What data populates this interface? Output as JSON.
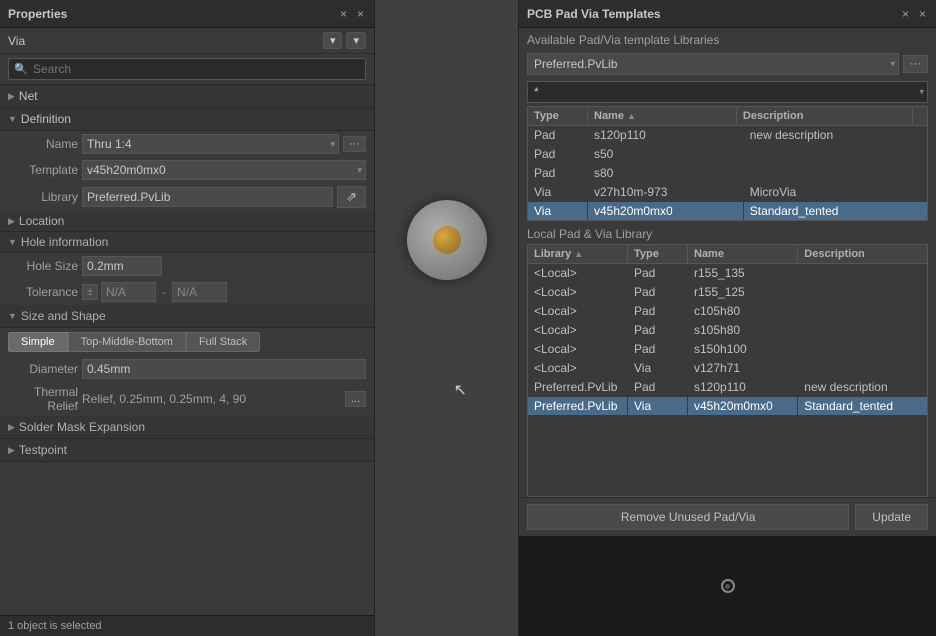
{
  "properties": {
    "title": "Properties",
    "via_label": "Via",
    "search_placeholder": "Search",
    "net_section": "Net",
    "definition_section": "Definition",
    "name_label": "Name",
    "name_value": "Thru 1:4",
    "template_label": "Template",
    "template_value": "v45h20m0mx0",
    "library_label": "Library",
    "library_value": "Preferred.PvLib",
    "location_section": "Location",
    "hole_info_section": "Hole information",
    "hole_size_label": "Hole Size",
    "hole_size_value": "0.2mm",
    "tolerance_label": "Tolerance",
    "tolerance_pm": "±",
    "tolerance_na": "N/A",
    "size_shape_section": "Size and Shape",
    "tab_simple": "Simple",
    "tab_top_middle_bottom": "Top-Middle-Bottom",
    "tab_full_stack": "Full Stack",
    "diameter_label": "Diameter",
    "diameter_value": "0.45mm",
    "thermal_label": "Thermal Relief",
    "thermal_value": "Relief, 0.25mm, 0.25mm, 4, 90",
    "thermal_dots": "...",
    "solder_mask": "Solder Mask Expansion",
    "testpoint": "Testpoint",
    "status": "1 object is selected",
    "close_btn": "×",
    "pin_btn": "×"
  },
  "templates": {
    "title": "PCB Pad Via Templates",
    "avail_label": "Available Pad/Via template Libraries",
    "library_select_value": "Preferred.PvLib",
    "filter_value": "*",
    "close_btn": "×",
    "pin_btn": "×",
    "avail_table": {
      "columns": [
        "Type",
        "Name",
        "Description"
      ],
      "rows": [
        {
          "type": "Pad",
          "name": "s120p110",
          "desc": "new description",
          "selected": false
        },
        {
          "type": "Pad",
          "name": "s50",
          "desc": "",
          "selected": false
        },
        {
          "type": "Pad",
          "name": "s80",
          "desc": "",
          "selected": false
        },
        {
          "type": "Via",
          "name": "v27h10m-973",
          "desc": "MicroVia",
          "selected": false
        },
        {
          "type": "Via",
          "name": "v45h20m0mx0",
          "desc": "Standard_tented",
          "selected": true
        }
      ]
    },
    "local_label": "Local Pad & Via Library",
    "local_table": {
      "columns": [
        "Library",
        "Type",
        "Name",
        "Description"
      ],
      "rows": [
        {
          "lib": "<Local>",
          "type": "Pad",
          "name": "r155_135",
          "desc": "",
          "selected": false
        },
        {
          "lib": "<Local>",
          "type": "Pad",
          "name": "r155_125",
          "desc": "",
          "selected": false
        },
        {
          "lib": "<Local>",
          "type": "Pad",
          "name": "c105h80",
          "desc": "",
          "selected": false
        },
        {
          "lib": "<Local>",
          "type": "Pad",
          "name": "s105h80",
          "desc": "",
          "selected": false
        },
        {
          "lib": "<Local>",
          "type": "Pad",
          "name": "s150h100",
          "desc": "",
          "selected": false
        },
        {
          "lib": "<Local>",
          "type": "Via",
          "name": "v127h71",
          "desc": "",
          "selected": false
        },
        {
          "lib": "Preferred.PvLib",
          "type": "Pad",
          "name": "s120p110",
          "desc": "new description",
          "selected": false
        },
        {
          "lib": "Preferred.PvLib",
          "type": "Via",
          "name": "v45h20m0mx0",
          "desc": "Standard_tented",
          "selected": true
        }
      ]
    },
    "remove_btn": "Remove Unused Pad/Via",
    "update_btn": "Update"
  }
}
